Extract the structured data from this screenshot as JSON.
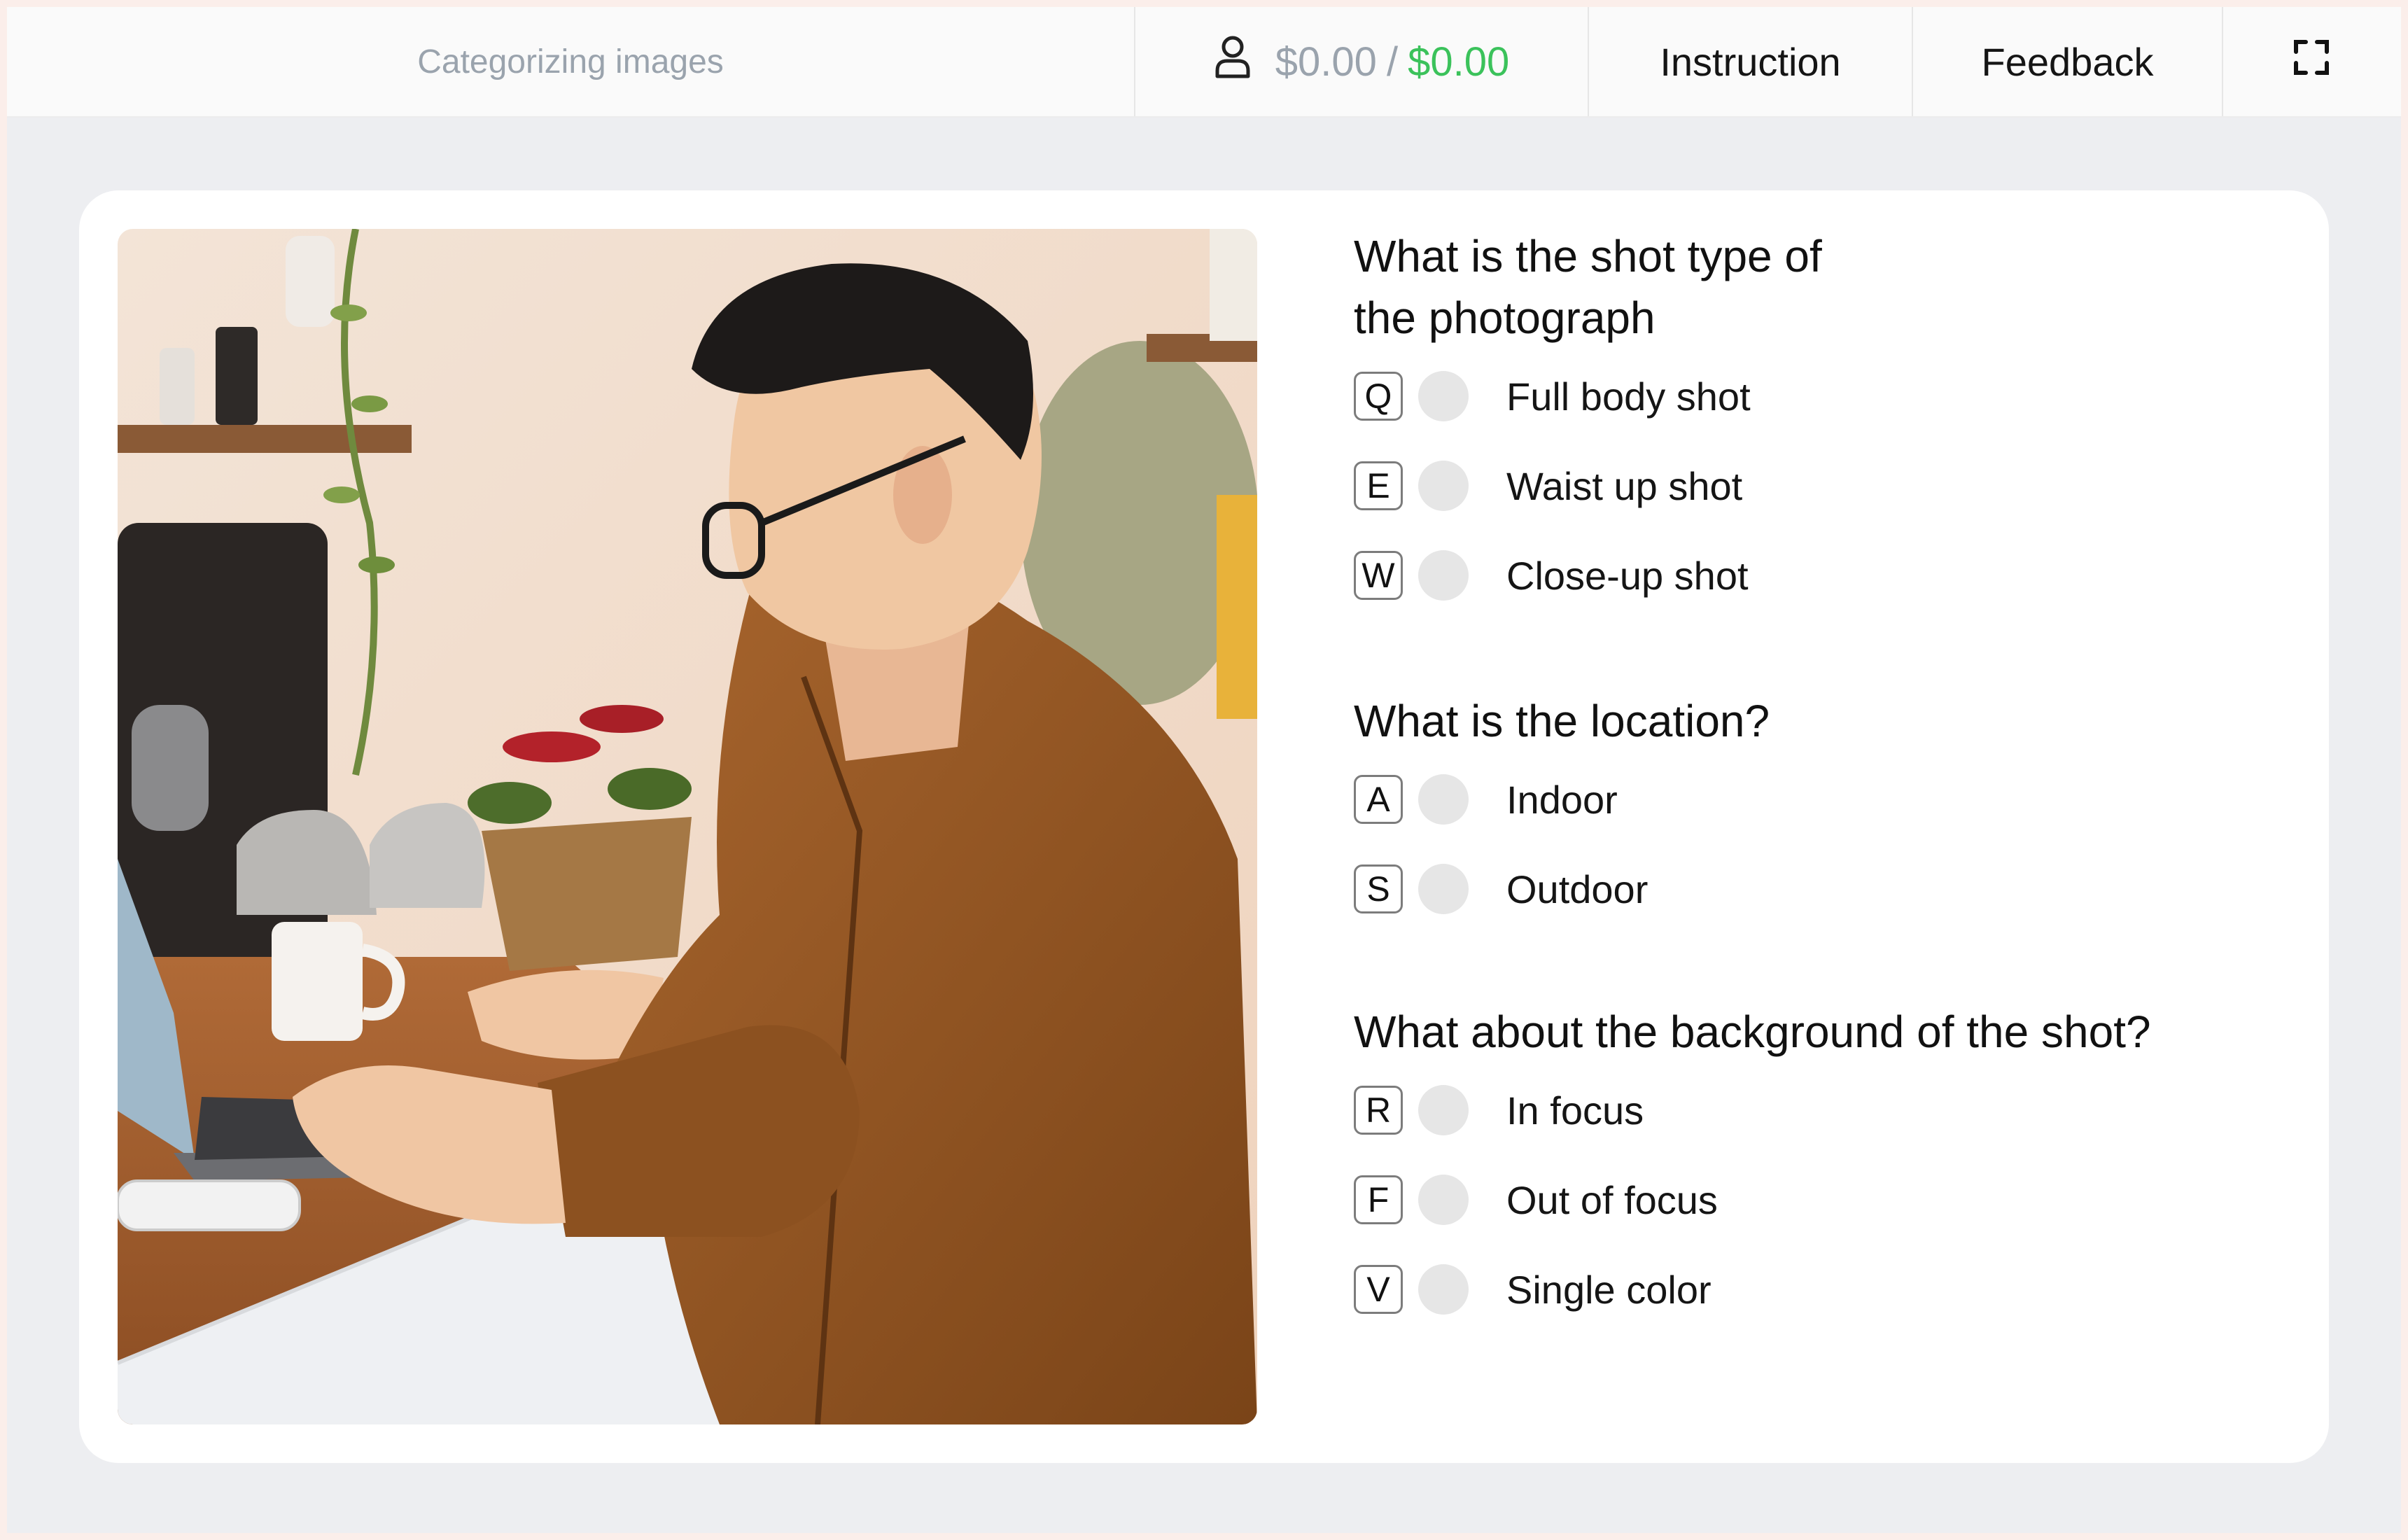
{
  "header": {
    "title": "Categorizing images",
    "balance_pending": "$0.00",
    "balance_separator": "/",
    "balance_earned": "$0.00",
    "instruction_label": "Instruction",
    "feedback_label": "Feedback",
    "user_icon": "user-icon",
    "fullscreen_icon": "fullscreen-icon"
  },
  "colors": {
    "earned": "#3bc25b",
    "muted": "#9aa3ad",
    "canvas": "#edeef1"
  },
  "questions": [
    {
      "title": "What is the shot type of the photograph",
      "options": [
        {
          "key": "Q",
          "label": "Full body shot"
        },
        {
          "key": "E",
          "label": "Waist up shot"
        },
        {
          "key": "W",
          "label": "Close-up shot"
        }
      ]
    },
    {
      "title": "What is the location?",
      "options": [
        {
          "key": "A",
          "label": "Indoor"
        },
        {
          "key": "S",
          "label": "Outdoor"
        }
      ]
    },
    {
      "title": "What about the background of the shot?",
      "options": [
        {
          "key": "R",
          "label": "In focus"
        },
        {
          "key": "F",
          "label": "Out of focus"
        },
        {
          "key": "V",
          "label": "Single color"
        }
      ]
    }
  ]
}
